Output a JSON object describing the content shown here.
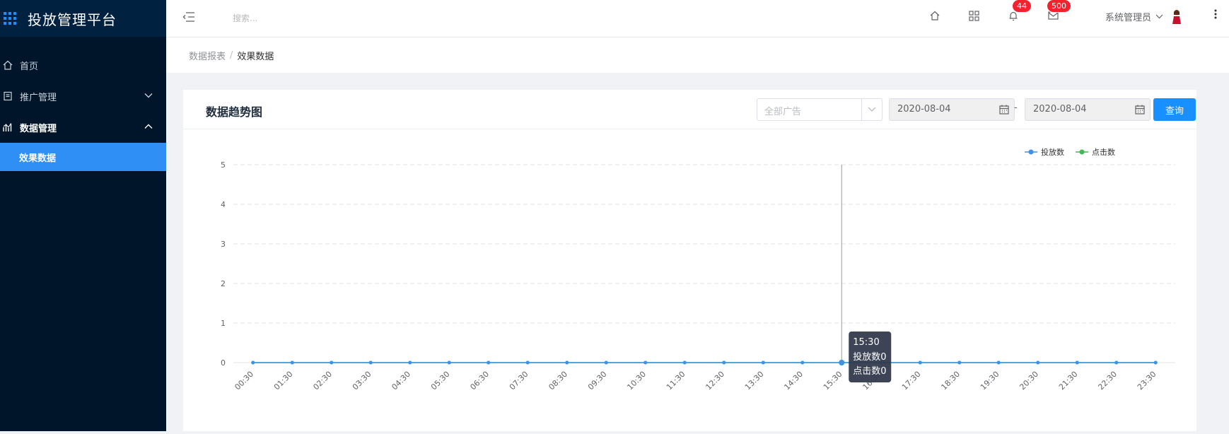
{
  "app": {
    "title": "投放管理平台"
  },
  "sidebar": {
    "items": [
      {
        "label": "首页",
        "icon": "home-icon"
      },
      {
        "label": "推广管理",
        "icon": "document-icon"
      },
      {
        "label": "数据管理",
        "icon": "chart-icon"
      }
    ],
    "active_sub": "效果数据"
  },
  "header": {
    "search_placeholder": "搜索...",
    "bell_count": "44",
    "mail_count": "500",
    "user_name": "系统管理员"
  },
  "breadcrumb": {
    "parent": "数据报表",
    "sep": "/",
    "current": "效果数据"
  },
  "card": {
    "title": "数据趋势图",
    "ad_select_placeholder": "全部广告",
    "date_start": "2020-08-04",
    "date_sep": "-",
    "date_end": "2020-08-04",
    "query_label": "查询"
  },
  "colors": {
    "series1": "#3b93e8",
    "series2": "#3fb950",
    "accent": "#1890ff"
  },
  "chart_data": {
    "type": "line",
    "title": "",
    "xlabel": "",
    "ylabel": "",
    "x": [
      "00:30",
      "01:30",
      "02:30",
      "03:30",
      "04:30",
      "05:30",
      "06:30",
      "07:30",
      "08:30",
      "09:30",
      "10:30",
      "11:30",
      "12:30",
      "13:30",
      "14:30",
      "15:30",
      "16:30",
      "17:30",
      "18:30",
      "19:30",
      "20:30",
      "21:30",
      "22:30",
      "23:30"
    ],
    "ylim": [
      0,
      5
    ],
    "yticks": [
      0,
      1,
      2,
      3,
      4,
      5
    ],
    "grid": true,
    "legend_position": "top-right",
    "series": [
      {
        "name": "投放数",
        "color": "#3b93e8",
        "values": [
          0,
          0,
          0,
          0,
          0,
          0,
          0,
          0,
          0,
          0,
          0,
          0,
          0,
          0,
          0,
          0,
          0,
          0,
          0,
          0,
          0,
          0,
          0,
          0
        ]
      },
      {
        "name": "点击数",
        "color": "#3fb950",
        "values": [
          0,
          0,
          0,
          0,
          0,
          0,
          0,
          0,
          0,
          0,
          0,
          0,
          0,
          0,
          0,
          0,
          0,
          0,
          0,
          0,
          0,
          0,
          0,
          0
        ]
      }
    ],
    "tooltip": {
      "x": "15:30",
      "lines": [
        "投放数0",
        "点击数0"
      ]
    }
  }
}
